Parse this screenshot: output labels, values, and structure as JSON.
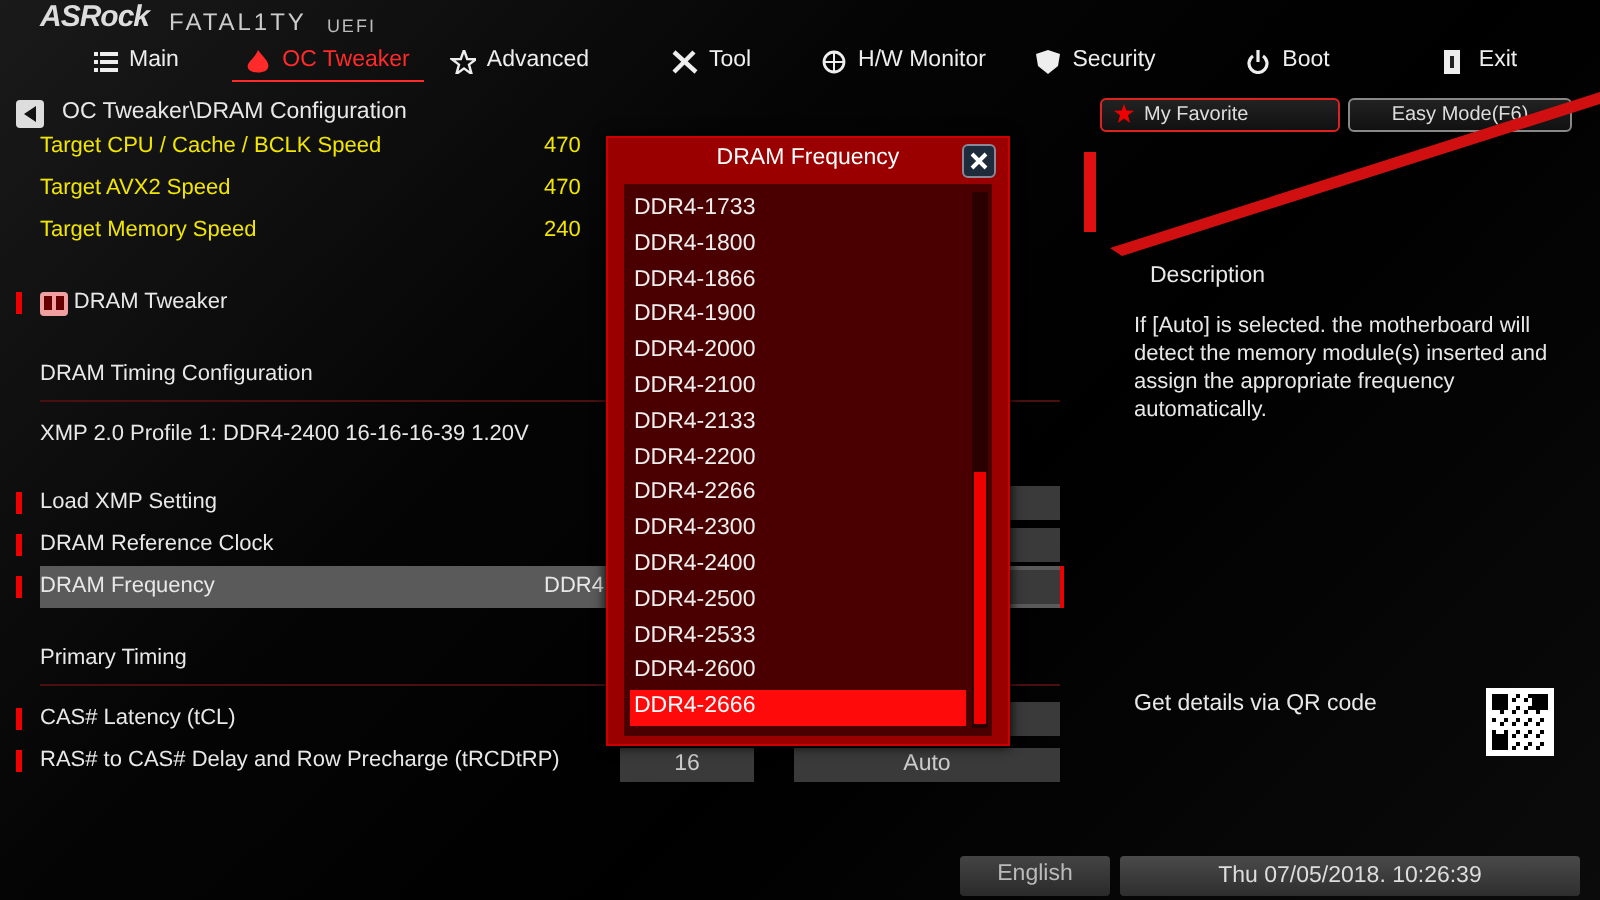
{
  "logo": {
    "brand": "ASRock",
    "product": "FATAL1TY",
    "suffix": "UEFI"
  },
  "tabs": [
    {
      "label": "Main",
      "kind": "list",
      "selected": false
    },
    {
      "label": "OC Tweaker",
      "kind": "flame",
      "selected": true
    },
    {
      "label": "Advanced",
      "kind": "star",
      "selected": false
    },
    {
      "label": "Tool",
      "kind": "tools",
      "selected": false
    },
    {
      "label": "H/W Monitor",
      "kind": "gauge",
      "selected": false
    },
    {
      "label": "Security",
      "kind": "shield",
      "selected": false
    },
    {
      "label": "Boot",
      "kind": "power",
      "selected": false
    },
    {
      "label": "Exit",
      "kind": "exit",
      "selected": false
    }
  ],
  "breadcrumb": "OC Tweaker\\DRAM Configuration",
  "favorite_button": "My Favorite",
  "easy_mode_button": "Easy Mode(F6)",
  "items": [
    {
      "kind": "info",
      "label": "Target CPU / Cache / BCLK Speed",
      "value": "470"
    },
    {
      "kind": "info",
      "label": "Target AVX2 Speed",
      "value": "470"
    },
    {
      "kind": "info",
      "label": "Target Memory Speed",
      "value": "240"
    },
    {
      "kind": "submenu",
      "label": "DRAM Tweaker"
    },
    {
      "kind": "section",
      "label": "DRAM Timing Configuration"
    },
    {
      "kind": "text",
      "label": "XMP 2.0 Profile 1: DDR4-2400 16-16-16-39 1.20V"
    },
    {
      "kind": "setting",
      "label": "Load XMP Setting",
      "selected": false
    },
    {
      "kind": "setting",
      "label": "DRAM Reference Clock",
      "selected": false
    },
    {
      "kind": "setting",
      "label": "DRAM Frequency",
      "value": "DDR4",
      "selected": true
    },
    {
      "kind": "section",
      "label": "Primary Timing"
    },
    {
      "kind": "setting",
      "label": "CAS# Latency (tCL)",
      "selected": false
    },
    {
      "kind": "setting",
      "label": "RAS# to CAS# Delay and Row Precharge (tRCDtRP)",
      "fields": [
        "16",
        "Auto"
      ],
      "selected": false
    }
  ],
  "dropdown": {
    "title": "DRAM Frequency",
    "options": [
      {
        "label": "DDR4-1733",
        "selected": false
      },
      {
        "label": "DDR4-1800",
        "selected": false
      },
      {
        "label": "DDR4-1866",
        "selected": false
      },
      {
        "label": "DDR4-1900",
        "selected": false
      },
      {
        "label": "DDR4-2000",
        "selected": false
      },
      {
        "label": "DDR4-2100",
        "selected": false
      },
      {
        "label": "DDR4-2133",
        "selected": false
      },
      {
        "label": "DDR4-2200",
        "selected": false
      },
      {
        "label": "DDR4-2266",
        "selected": false
      },
      {
        "label": "DDR4-2300",
        "selected": false
      },
      {
        "label": "DDR4-2400",
        "selected": false
      },
      {
        "label": "DDR4-2500",
        "selected": false
      },
      {
        "label": "DDR4-2533",
        "selected": false
      },
      {
        "label": "DDR4-2600",
        "selected": false
      },
      {
        "label": "DDR4-2666",
        "selected": true
      }
    ]
  },
  "description": {
    "title": "Description",
    "text": "If [Auto] is selected. the motherboard will detect the memory module(s) inserted and assign the appropriate frequency automatically.",
    "qr_caption": "Get details via QR code"
  },
  "status_bar": {
    "language": "English",
    "datetime": "Thu 07/05/2018. 10:26:39"
  }
}
